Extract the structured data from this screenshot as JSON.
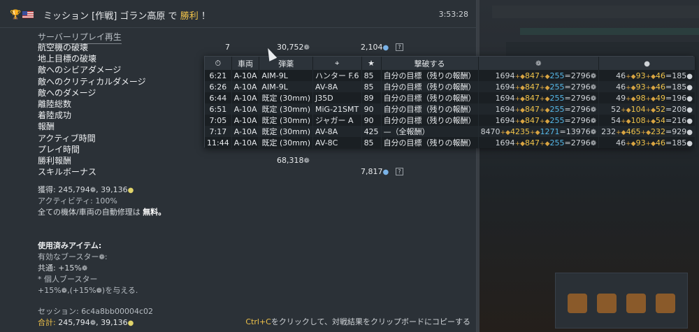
{
  "header": {
    "title_prefix": "ミッション [作戦] ゴラン高原 で",
    "title_win": "勝利",
    "title_suffix": "！",
    "time": "3:53:28"
  },
  "replay_label": "サーバーリプレイ再生",
  "rows": [
    {
      "label": "航空機の破壊",
      "count": "7",
      "sl": "30,752",
      "rp": "2,104",
      "help": "?"
    },
    {
      "label": "地上目標の破壊"
    },
    {
      "label": "敵へのシビアダメージ"
    },
    {
      "label": "敵へのクリティカルダメージ"
    },
    {
      "label": "敵へのダメージ"
    },
    {
      "label": "離陸総数"
    },
    {
      "label": "着陸成功"
    },
    {
      "label": "報酬"
    },
    {
      "label": "アクティブ時間"
    },
    {
      "label": "プレイ時間"
    },
    {
      "label": "勝利報酬",
      "sl": "68,318"
    },
    {
      "label": "スキルボーナス",
      "rp": "7,817",
      "help": "?"
    }
  ],
  "summary": {
    "earned_label": "獲得: 245,794",
    "earned_rp": ", 39,136",
    "activity": "アクティビティ: 100%",
    "repair_text": "全ての機体/車両の自動修理は",
    "repair_free": "無料。",
    "items_header": "使用済みアイテム:",
    "boosters": "有効なブースター",
    "common": "共通: +15%",
    "personal": "* 個人ブースター",
    "gives_pre": "+15%",
    "gives_mid": "(+15%",
    "gives_post": ")を与える.",
    "session": "セッション: 6c4a8bb00004c02",
    "total_label": "合計:",
    "total_value": "245,794",
    "total_rp": ", 39,136"
  },
  "hint": {
    "key": "Ctrl+C",
    "text": "をクリックして、対戦結果をクリップボードにコピーする"
  },
  "table": {
    "headers": [
      "⏱",
      "車両",
      "弾薬",
      "⌖",
      "★",
      "撃破する",
      "",
      ""
    ],
    "rows": [
      {
        "time": "6:21",
        "vehicle": "A-10A",
        "ammo": "AIM-9L",
        "target": "ハンター F.6",
        "score": "85",
        "reason": "自分の目標（残りの報酬）",
        "sl": [
          "1694",
          "847",
          "255",
          "2796"
        ],
        "rp": [
          "46",
          "93",
          "46",
          "185"
        ]
      },
      {
        "time": "6:26",
        "vehicle": "A-10A",
        "ammo": "AIM-9L",
        "target": "AV-8A",
        "score": "85",
        "reason": "自分の目標（残りの報酬）",
        "sl": [
          "1694",
          "847",
          "255",
          "2796"
        ],
        "rp": [
          "46",
          "93",
          "46",
          "185"
        ]
      },
      {
        "time": "6:44",
        "vehicle": "A-10A",
        "ammo": "既定 (30mm)",
        "target": "J35D",
        "score": "89",
        "reason": "自分の目標（残りの報酬）",
        "sl": [
          "1694",
          "847",
          "255",
          "2796"
        ],
        "rp": [
          "49",
          "98",
          "49",
          "196"
        ]
      },
      {
        "time": "6:51",
        "vehicle": "A-10A",
        "ammo": "既定 (30mm)",
        "target": "MiG-21SMT",
        "score": "90",
        "reason": "自分の目標（残りの報酬）",
        "sl": [
          "1694",
          "847",
          "255",
          "2796"
        ],
        "rp": [
          "52",
          "104",
          "52",
          "208"
        ]
      },
      {
        "time": "7:05",
        "vehicle": "A-10A",
        "ammo": "既定 (30mm)",
        "target": "ジャガー A",
        "score": "90",
        "reason": "自分の目標（残りの報酬）",
        "sl": [
          "1694",
          "847",
          "255",
          "2796"
        ],
        "rp": [
          "54",
          "108",
          "54",
          "216"
        ]
      },
      {
        "time": "7:17",
        "vehicle": "A-10A",
        "ammo": "既定 (30mm)",
        "target": "AV-8A",
        "score": "425",
        "reason": "—（全報酬）",
        "sl": [
          "8470",
          "4235",
          "1271",
          "13976"
        ],
        "rp": [
          "232",
          "465",
          "232",
          "929"
        ]
      },
      {
        "time": "11:44",
        "vehicle": "A-10A",
        "ammo": "既定 (30mm)",
        "target": "AV-8C",
        "score": "85",
        "reason": "自分の目標（残りの報酬）",
        "sl": [
          "1694",
          "847",
          "255",
          "2796"
        ],
        "rp": [
          "46",
          "93",
          "46",
          "185"
        ]
      }
    ]
  }
}
